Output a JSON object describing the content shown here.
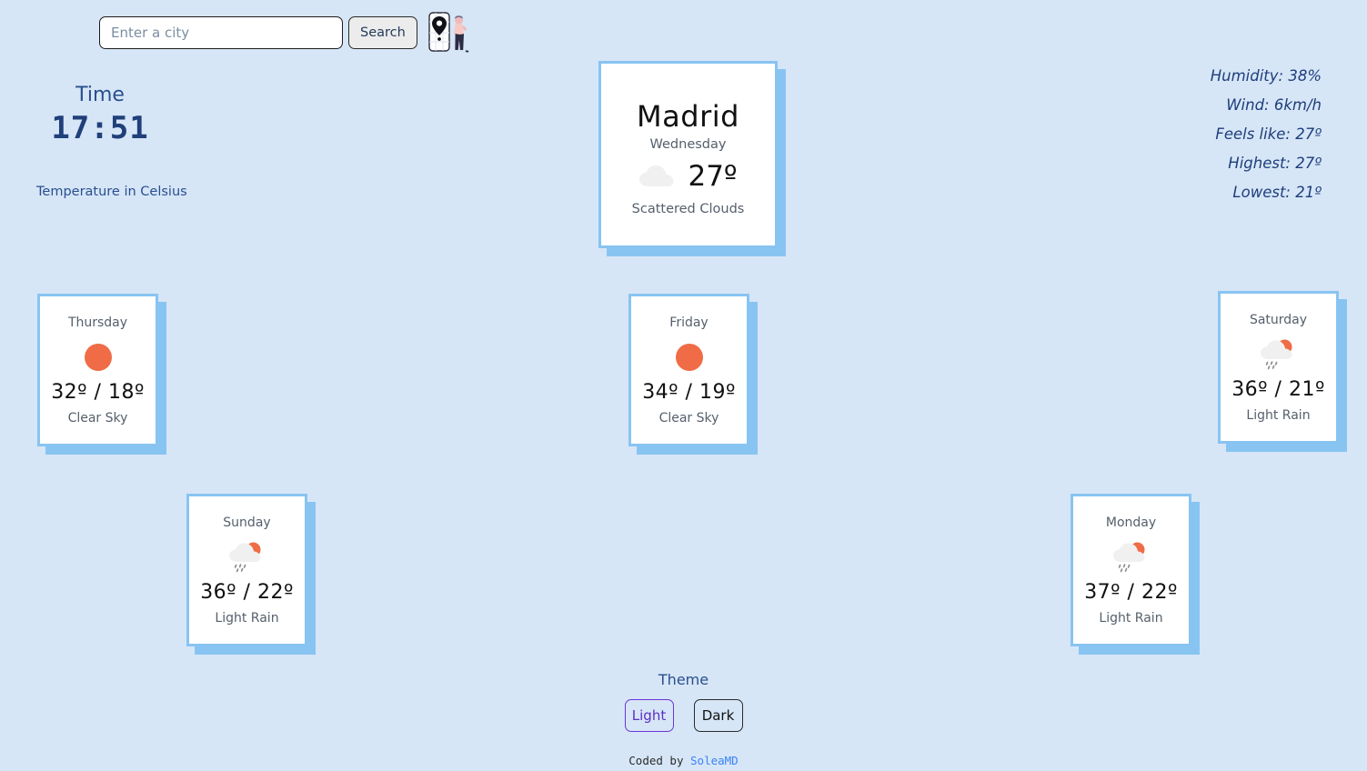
{
  "search": {
    "placeholder": "Enter a city",
    "value": "",
    "button_label": "Search"
  },
  "time_panel": {
    "label": "Time",
    "value": "17:51",
    "units_note": "Temperature in Celsius"
  },
  "stats": [
    {
      "text": "Humidity: 38%"
    },
    {
      "text": "Wind: 6km/h"
    },
    {
      "text": "Feels like: 27º"
    },
    {
      "text": "Highest: 27º"
    },
    {
      "text": "Lowest: 21º"
    }
  ],
  "current": {
    "city": "Madrid",
    "day": "Wednesday",
    "temperature": "27º",
    "description": "Scattered Clouds",
    "icon": "cloud-icon"
  },
  "forecast": [
    {
      "day": "Thursday",
      "temps": "32º / 18º",
      "description": "Clear Sky",
      "icon": "sun-icon"
    },
    {
      "day": "Friday",
      "temps": "34º / 19º",
      "description": "Clear Sky",
      "icon": "sun-icon"
    },
    {
      "day": "Saturday",
      "temps": "36º / 21º",
      "description": "Light Rain",
      "icon": "sun-cloud-rain-icon"
    },
    {
      "day": "Sunday",
      "temps": "36º / 22º",
      "description": "Light Rain",
      "icon": "sun-cloud-rain-icon"
    },
    {
      "day": "Monday",
      "temps": "37º / 22º",
      "description": "Light Rain",
      "icon": "sun-cloud-rain-icon"
    }
  ],
  "theme": {
    "title": "Theme",
    "light_label": "Light",
    "dark_label": "Dark",
    "selected": "Light"
  },
  "footer": {
    "prefix": "Coded by ",
    "author": "SoleaMD"
  },
  "colors": {
    "background": "#d6e6f7",
    "card_border": "#88c4f2",
    "accent_text": "#1f3e7a",
    "sun": "#ef6c46",
    "cloud": "#f0f0f0",
    "light_button": "#6b36d6",
    "link": "#3b82f6"
  }
}
